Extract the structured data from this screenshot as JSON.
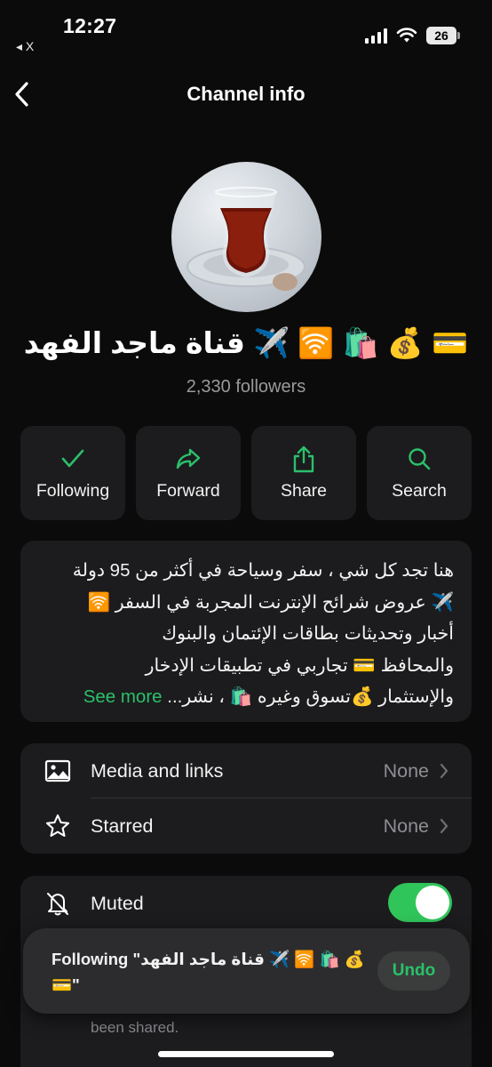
{
  "status": {
    "time": "12:27",
    "back_app": "◂ X",
    "battery": "26"
  },
  "nav": {
    "title": "Channel info"
  },
  "channel": {
    "name": "قناة ماجد الفهد ✈️ 🛜 🛍️ 💰 💳",
    "followers": "2,330 followers"
  },
  "actions": [
    {
      "label": "Following",
      "icon": "checkmark-icon"
    },
    {
      "label": "Forward",
      "icon": "forward-arrow-icon"
    },
    {
      "label": "Share",
      "icon": "share-icon"
    },
    {
      "label": "Search",
      "icon": "search-icon"
    }
  ],
  "description": {
    "lines": [
      "هنا تجد كل شي ، سفر وسياحة في أكثر من 95 دولة",
      "✈️ عروض شرائح الإنترنت المجربة في السفر 🛜",
      "أخبار وتحديثات بطاقات الإئتمان والبنوك",
      "والمحافظ 💳 تجاربي في تطبيقات الإدخار",
      "والإستثمار 💰تسوق وغيره 🛍️ ، نشر..."
    ],
    "see_more": "See more"
  },
  "list": {
    "media": {
      "label": "Media and links",
      "value": "None"
    },
    "starred": {
      "label": "Starred",
      "value": "None"
    },
    "muted": {
      "label": "Muted",
      "on": true
    }
  },
  "below": {
    "text": "been shared."
  },
  "toast": {
    "text": "Following \"قناة ماجد الفهد ✈️ 🛜 🛍️ 💰 💳\"",
    "undo": "Undo"
  },
  "colors": {
    "accent": "#2bc06a",
    "background": "#0b0b0b",
    "card": "#1c1c1e",
    "toggle_on": "#30c55a"
  }
}
